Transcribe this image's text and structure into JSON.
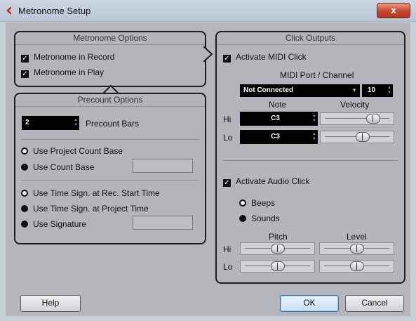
{
  "window": {
    "title": "Metronome Setup",
    "close_label": "x"
  },
  "metronome_options": {
    "header": "Metronome Options",
    "in_record": "Metronome in Record",
    "in_play": "Metronome in Play"
  },
  "precount_options": {
    "header": "Precount Options",
    "bars_value": "2",
    "bars_label": "Precount Bars",
    "use_project_count_base": "Use Project Count Base",
    "use_count_base": "Use Count Base",
    "use_time_sign_rec_start": "Use Time Sign. at Rec. Start Time",
    "use_time_sign_project": "Use Time Sign. at Project Time",
    "use_signature": "Use Signature"
  },
  "click_outputs": {
    "header": "Click Outputs",
    "activate_midi": "Activate MIDI Click",
    "midi_port_label": "MIDI Port / Channel",
    "port_value": "Not Connected",
    "channel_value": "10",
    "note_header": "Note",
    "velocity_header": "Velocity",
    "hi_label": "Hi",
    "lo_label": "Lo",
    "hi_note": "C3",
    "lo_note": "C3",
    "hi_velocity": 0.8,
    "lo_velocity": 0.6,
    "activate_audio": "Activate Audio Click",
    "beeps": "Beeps",
    "sounds": "Sounds",
    "pitch_header": "Pitch",
    "level_header": "Level",
    "hi_pitch": 0.5,
    "lo_pitch": 0.5,
    "hi_level": 0.5,
    "lo_level": 0.5
  },
  "buttons": {
    "help": "Help",
    "ok": "OK",
    "cancel": "Cancel"
  }
}
